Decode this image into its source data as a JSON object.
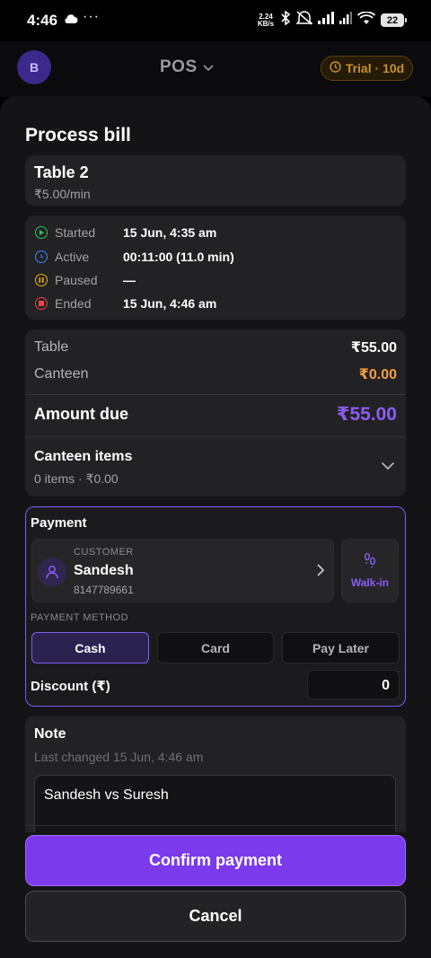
{
  "status_bar": {
    "time": "4:46",
    "network_speed_value": "2.24",
    "network_speed_unit": "KB/s",
    "battery": "22"
  },
  "header": {
    "avatar_initial": "B",
    "title": "POS",
    "trial_label": "Trial · 10d"
  },
  "sheet": {
    "title": "Process bill",
    "table": {
      "name": "Table 2",
      "rate": "₹5.00/min"
    },
    "times": [
      {
        "label": "Started",
        "value": "15 Jun, 4:35 am",
        "color": "#22c55e"
      },
      {
        "label": "Active",
        "value": "00:11:00 (11.0 min)",
        "color": "#3b82f6"
      },
      {
        "label": "Paused",
        "value": "—",
        "color": "#eab308"
      },
      {
        "label": "Ended",
        "value": "15 Jun, 4:46 am",
        "color": "#ef4444"
      }
    ],
    "amounts": {
      "table_label": "Table",
      "table_value": "₹55.00",
      "canteen_label": "Canteen",
      "canteen_value": "₹0.00",
      "due_label": "Amount due",
      "due_value": "₹55.00"
    },
    "canteen_items": {
      "title": "Canteen items",
      "summary": "0 items · ₹0.00"
    },
    "payment": {
      "title": "Payment",
      "customer_label": "CUSTOMER",
      "customer_name": "Sandesh",
      "customer_phone": "8147789661",
      "walkin_label": "Walk-in",
      "method_label": "PAYMENT METHOD",
      "methods": [
        "Cash",
        "Card",
        "Pay Later"
      ],
      "selected_method": "Cash",
      "discount_label": "Discount (₹)",
      "discount_value": "0"
    },
    "note": {
      "title": "Note",
      "last_changed": "Last changed 15 Jun, 4:46 am",
      "text": "Sandesh vs Suresh"
    },
    "confirm_label": "Confirm payment",
    "cancel_label": "Cancel"
  },
  "colors": {
    "accent": "#7c3aed",
    "canteen_amount": "#f59e42",
    "due_amount": "#8b5cf6",
    "trial": "#c79325"
  }
}
